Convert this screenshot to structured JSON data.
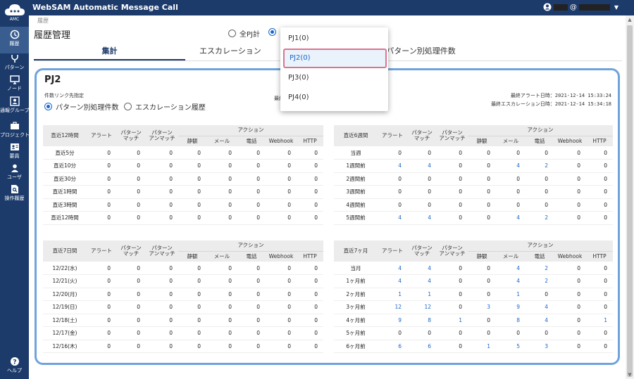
{
  "app": {
    "title": "WebSAM Automatic Message Call",
    "logo_text": "AMC",
    "user_at": "@"
  },
  "sidebar": {
    "items": [
      {
        "label": "履歴"
      },
      {
        "label": "パターン"
      },
      {
        "label": "ノード"
      },
      {
        "label": "通報グループ"
      },
      {
        "label": "プロジェクト"
      },
      {
        "label": "要員"
      },
      {
        "label": "ユーザ"
      },
      {
        "label": "操作履歴"
      }
    ],
    "help": "ヘルプ"
  },
  "breadcrumb": "履歴",
  "page_title": "履歴管理",
  "scope": {
    "all": "全PJ計"
  },
  "tabs": [
    "集計",
    "エスカレーション",
    "パターン別処理件数"
  ],
  "panel": {
    "project": "PJ2",
    "link_label": "件数リンク先指定",
    "link_options": [
      "パターン別処理件数",
      "エスカレーション履歴"
    ],
    "last_prefix": "最終",
    "last_alert": "最終アラート日時：2021-12-14 15:33:24",
    "last_escalation": "最終エスカレーション日時：2021-12-14 15:34:18"
  },
  "dropdown": {
    "options": [
      "PJ1(0)",
      "PJ2(0)",
      "PJ3(0)",
      "PJ4(0)"
    ],
    "selected": "PJ2(0)"
  },
  "cols": {
    "alert": "アラート",
    "pmatch": "パターン\nマッチ",
    "punmatch": "パターン\nアンマッチ",
    "action": "アクション",
    "quiet": "静観",
    "mail": "メール",
    "phone": "電話",
    "webhook": "Webhook",
    "http": "HTTP"
  },
  "tables": [
    {
      "title": "直近12時間",
      "rows": [
        [
          "直近5分",
          "0",
          "0",
          "0",
          "0",
          "0",
          "0",
          "0",
          "0"
        ],
        [
          "直近10分",
          "0",
          "0",
          "0",
          "0",
          "0",
          "0",
          "0",
          "0"
        ],
        [
          "直近30分",
          "0",
          "0",
          "0",
          "0",
          "0",
          "0",
          "0",
          "0"
        ],
        [
          "直近1時間",
          "0",
          "0",
          "0",
          "0",
          "0",
          "0",
          "0",
          "0"
        ],
        [
          "直近3時間",
          "0",
          "0",
          "0",
          "0",
          "0",
          "0",
          "0",
          "0"
        ],
        [
          "直近12時間",
          "0",
          "0",
          "0",
          "0",
          "0",
          "0",
          "0",
          "0"
        ]
      ]
    },
    {
      "title": "直近6週間",
      "rows": [
        [
          "当週",
          "0",
          "0",
          "0",
          "0",
          "0",
          "0",
          "0",
          "0"
        ],
        [
          "1週間前",
          "4",
          "4",
          "0",
          "0",
          "4",
          "2",
          "0",
          "0"
        ],
        [
          "2週間前",
          "0",
          "0",
          "0",
          "0",
          "0",
          "0",
          "0",
          "0"
        ],
        [
          "3週間前",
          "0",
          "0",
          "0",
          "0",
          "0",
          "0",
          "0",
          "0"
        ],
        [
          "4週間前",
          "0",
          "0",
          "0",
          "0",
          "0",
          "0",
          "0",
          "0"
        ],
        [
          "5週間前",
          "4",
          "4",
          "0",
          "0",
          "4",
          "2",
          "0",
          "0"
        ]
      ]
    },
    {
      "title": "直近7日間",
      "rows": [
        [
          "12/22(水)",
          "0",
          "0",
          "0",
          "0",
          "0",
          "0",
          "0",
          "0"
        ],
        [
          "12/21(火)",
          "0",
          "0",
          "0",
          "0",
          "0",
          "0",
          "0",
          "0"
        ],
        [
          "12/20(月)",
          "0",
          "0",
          "0",
          "0",
          "0",
          "0",
          "0",
          "0"
        ],
        [
          "12/19(日)",
          "0",
          "0",
          "0",
          "0",
          "0",
          "0",
          "0",
          "0"
        ],
        [
          "12/18(土)",
          "0",
          "0",
          "0",
          "0",
          "0",
          "0",
          "0",
          "0"
        ],
        [
          "12/17(金)",
          "0",
          "0",
          "0",
          "0",
          "0",
          "0",
          "0",
          "0"
        ],
        [
          "12/16(木)",
          "0",
          "0",
          "0",
          "0",
          "0",
          "0",
          "0",
          "0"
        ]
      ]
    },
    {
      "title": "直近7ヶ月",
      "rows": [
        [
          "当月",
          "4",
          "4",
          "0",
          "0",
          "4",
          "2",
          "0",
          "0"
        ],
        [
          "1ヶ月前",
          "4",
          "4",
          "0",
          "0",
          "4",
          "2",
          "0",
          "0"
        ],
        [
          "2ヶ月前",
          "1",
          "1",
          "0",
          "0",
          "1",
          "0",
          "0",
          "0"
        ],
        [
          "3ヶ月前",
          "12",
          "12",
          "0",
          "3",
          "9",
          "4",
          "0",
          "0"
        ],
        [
          "4ヶ月前",
          "9",
          "8",
          "1",
          "0",
          "8",
          "4",
          "0",
          "1"
        ],
        [
          "5ヶ月前",
          "0",
          "0",
          "0",
          "0",
          "0",
          "0",
          "0",
          "0"
        ],
        [
          "6ヶ月前",
          "6",
          "6",
          "0",
          "1",
          "5",
          "3",
          "0",
          "0"
        ]
      ]
    }
  ]
}
